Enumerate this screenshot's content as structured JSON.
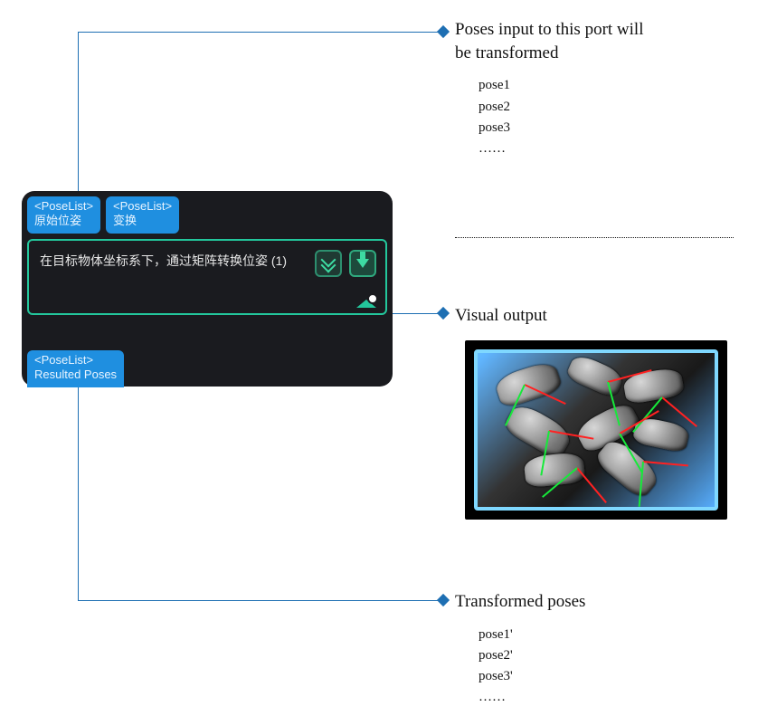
{
  "annotations": {
    "input": {
      "title_line1": "Poses input to this port will",
      "title_line2": "be transformed",
      "items": [
        "pose1",
        "pose2",
        "pose3",
        "……"
      ]
    },
    "visual_output": {
      "label": "Visual output"
    },
    "output": {
      "title": "Transformed poses",
      "items": [
        "pose1'",
        "pose2'",
        "pose3'",
        "……"
      ]
    }
  },
  "node": {
    "input_ports": [
      {
        "type": "<PoseList>",
        "label": "原始位姿"
      },
      {
        "type": "<PoseList>",
        "label": "变换"
      }
    ],
    "title": "在目标物体坐标系下，通过矩阵转换位姿 (1)",
    "icons": {
      "expand": "double-chevron-down",
      "collapse": "arrow-down",
      "visual": "visual-output-eye"
    },
    "output_port": {
      "type": "<PoseList>",
      "label": "Resulted Poses"
    }
  },
  "colors": {
    "connector": "#1e6fb3",
    "node_bg": "#1a1b1f",
    "port_bg": "#1f8fe0",
    "accent_green": "#23c79c"
  }
}
